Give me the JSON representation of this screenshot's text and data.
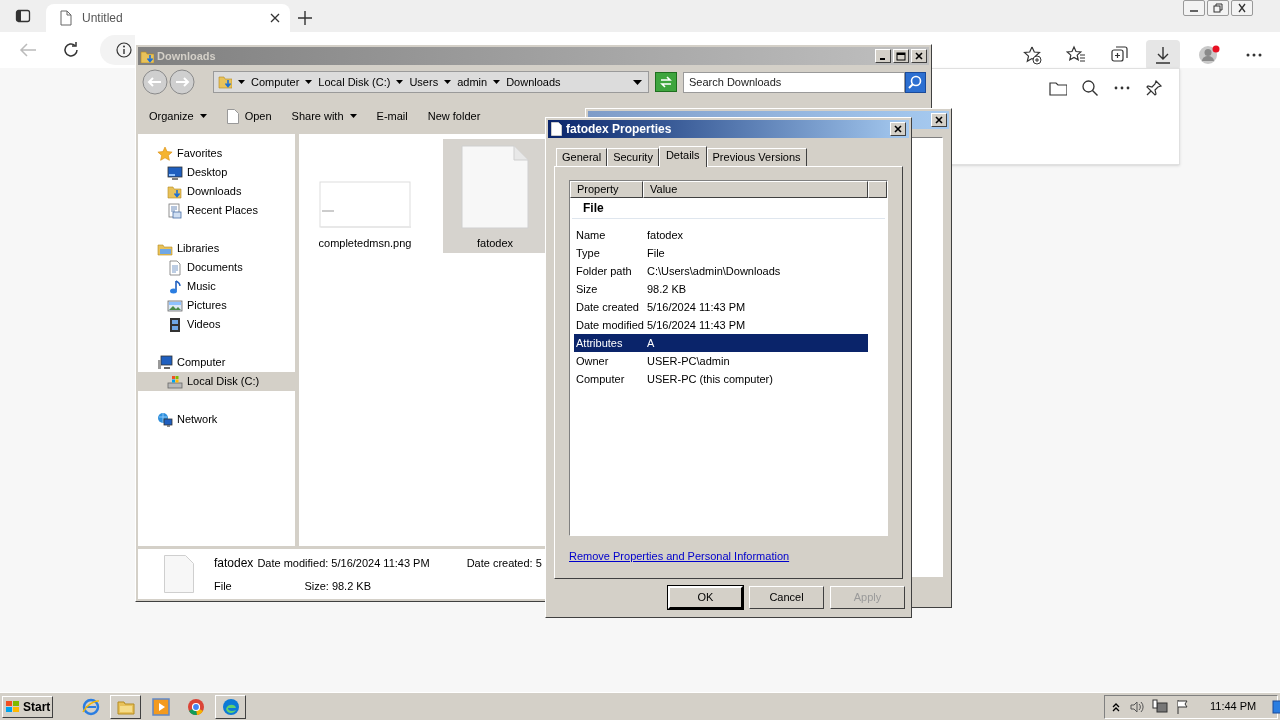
{
  "browser": {
    "tab": {
      "title": "Untitled"
    }
  },
  "explorer": {
    "title": "Downloads",
    "breadcrumb": [
      "Computer",
      "Local Disk (C:)",
      "Users",
      "admin",
      "Downloads"
    ],
    "search": {
      "placeholder": "Search Downloads"
    },
    "toolbar": [
      {
        "label": "Organize",
        "kind": "menu"
      },
      {
        "label": "Open",
        "kind": "file"
      },
      {
        "label": "Share with",
        "kind": "menu"
      },
      {
        "label": "E-mail",
        "kind": "plain"
      },
      {
        "label": "New folder",
        "kind": "plain"
      }
    ],
    "sidebar": [
      {
        "label": "Favorites",
        "kind": "star",
        "selected": false,
        "children": [
          {
            "label": "Desktop",
            "kind": "desktop",
            "selected": false
          },
          {
            "label": "Downloads",
            "kind": "folder",
            "selected": false
          },
          {
            "label": "Recent Places",
            "kind": "recent",
            "selected": false
          }
        ]
      },
      {
        "label": "Libraries",
        "kind": "library",
        "selected": false,
        "children": [
          {
            "label": "Documents",
            "kind": "document",
            "selected": false
          },
          {
            "label": "Music",
            "kind": "music",
            "selected": false
          },
          {
            "label": "Pictures",
            "kind": "pictures",
            "selected": false
          },
          {
            "label": "Videos",
            "kind": "videos",
            "selected": false
          }
        ]
      },
      {
        "label": "Computer",
        "kind": "computer",
        "selected": false,
        "children": [
          {
            "label": "Local Disk (C:)",
            "kind": "disk",
            "selected": true
          }
        ]
      },
      {
        "label": "Network",
        "kind": "network",
        "selected": false
      }
    ],
    "files": [
      {
        "name": "completedmsn.png",
        "kind": "image",
        "selected": false
      },
      {
        "name": "fatodex",
        "kind": "blank",
        "selected": true
      }
    ],
    "details_pane": {
      "name": "fatodex",
      "type": "File",
      "modified": "Date modified: 5/16/2024 11:43 PM",
      "size": "Size: 98.2 KB",
      "created": "Date created: 5"
    }
  },
  "properties": {
    "title": "fatodex Properties",
    "tabs": [
      {
        "label": "General",
        "selected": false
      },
      {
        "label": "Security",
        "selected": false
      },
      {
        "label": "Details",
        "selected": true
      },
      {
        "label": "Previous Versions",
        "selected": false
      }
    ],
    "columns": [
      "Property",
      "Value"
    ],
    "group": "File",
    "rows": [
      {
        "property": "Name",
        "value": "fatodex",
        "selected": false
      },
      {
        "property": "Type",
        "value": "File",
        "selected": false
      },
      {
        "property": "Folder path",
        "value": "C:\\Users\\admin\\Downloads",
        "selected": false
      },
      {
        "property": "Size",
        "value": "98.2 KB",
        "selected": false
      },
      {
        "property": "Date created",
        "value": "5/16/2024 11:43 PM",
        "selected": false
      },
      {
        "property": "Date modified",
        "value": "5/16/2024 11:43 PM",
        "selected": false
      },
      {
        "property": "Attributes",
        "value": "A",
        "selected": true
      },
      {
        "property": "Owner",
        "value": "USER-PC\\admin",
        "selected": false
      },
      {
        "property": "Computer",
        "value": "USER-PC (this computer)",
        "selected": false
      }
    ],
    "link": "Remove Properties and Personal Information",
    "buttons": [
      {
        "label": "OK",
        "default": true,
        "disabled": false
      },
      {
        "label": "Cancel",
        "default": false,
        "disabled": false
      },
      {
        "label": "Apply",
        "default": false,
        "disabled": true
      }
    ]
  },
  "taskbar": {
    "start": "Start",
    "apps": [
      {
        "kind": "ie",
        "active": false
      },
      {
        "kind": "explorer",
        "active": true
      },
      {
        "kind": "media",
        "active": false
      },
      {
        "kind": "chrome",
        "active": false
      },
      {
        "kind": "edge",
        "active": true
      }
    ],
    "clock": "11:44 PM"
  }
}
